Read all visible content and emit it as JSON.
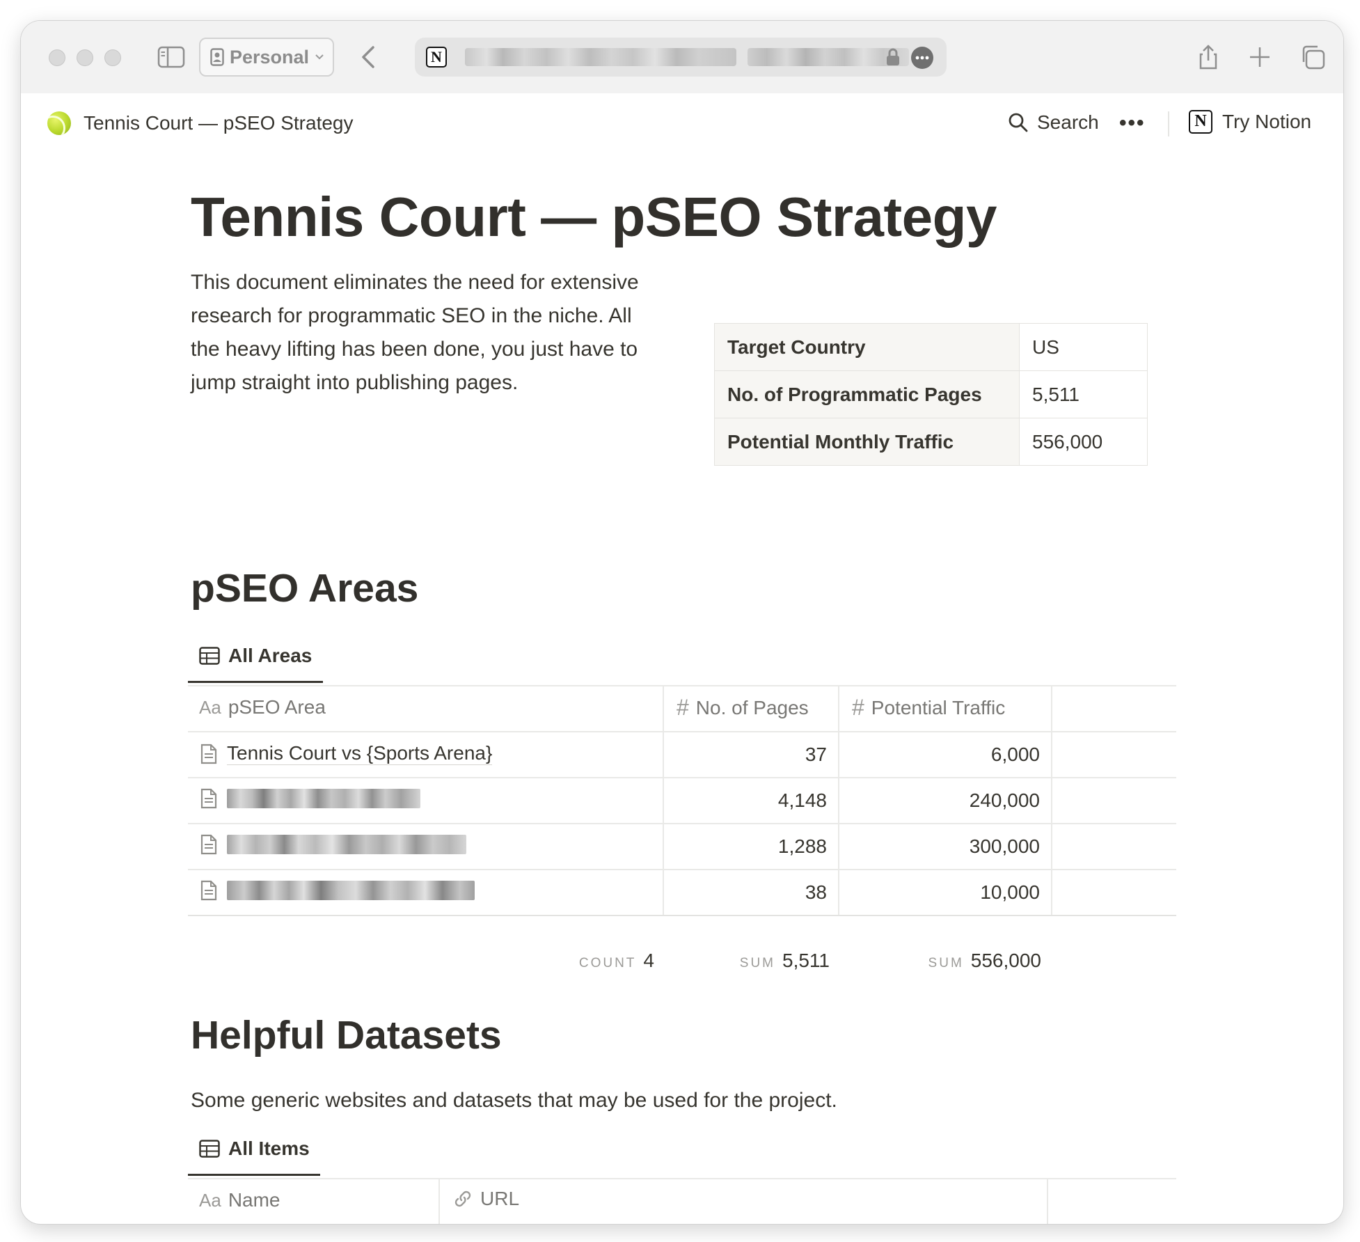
{
  "browser": {
    "profile_label": "Personal",
    "icons": [
      "sidebar-icon",
      "person-icon",
      "chevron-down-icon",
      "back-arrow-icon",
      "notion-logo-icon",
      "lock-icon",
      "ellipsis-icon",
      "share-icon",
      "plus-icon",
      "tabs-icon"
    ]
  },
  "topbar": {
    "breadcrumb_title": "Tennis Court — pSEO Strategy",
    "search_label": "Search",
    "more_label": "•••",
    "try_notion_label": "Try Notion"
  },
  "page": {
    "title": "Tennis Court — pSEO Strategy",
    "intro": "This document eliminates the need for extensive research for programmatic SEO in the niche. All the heavy lifting has been done, you just have to jump straight into publishing pages.",
    "summary": [
      {
        "label": "Target Country",
        "value": "US"
      },
      {
        "label": "No. of Programmatic Pages",
        "value": "5,511"
      },
      {
        "label": "Potential Monthly Traffic",
        "value": "556,000"
      }
    ]
  },
  "areas": {
    "heading": "pSEO Areas",
    "view_tab": "All Areas",
    "columns": {
      "name": "pSEO Area",
      "name_prefix": "Aa",
      "pages": "No. of Pages",
      "traffic": "Potential Traffic"
    },
    "rows": [
      {
        "name": "Tennis Court vs {Sports Arena}",
        "pages": "37",
        "traffic": "6,000"
      },
      {
        "name": "",
        "pages": "4,148",
        "traffic": "240,000"
      },
      {
        "name": "",
        "pages": "1,288",
        "traffic": "300,000"
      },
      {
        "name": "",
        "pages": "38",
        "traffic": "10,000"
      }
    ],
    "footer": {
      "count_label": "COUNT",
      "count_value": "4",
      "pages_sum_label": "SUM",
      "pages_sum_value": "5,511",
      "traffic_sum_label": "SUM",
      "traffic_sum_value": "556,000"
    }
  },
  "datasets": {
    "heading": "Helpful Datasets",
    "description": "Some generic websites and datasets that may be used for the project.",
    "view_tab": "All Items",
    "columns": {
      "name": "Name",
      "name_prefix": "Aa",
      "url": "URL"
    }
  }
}
